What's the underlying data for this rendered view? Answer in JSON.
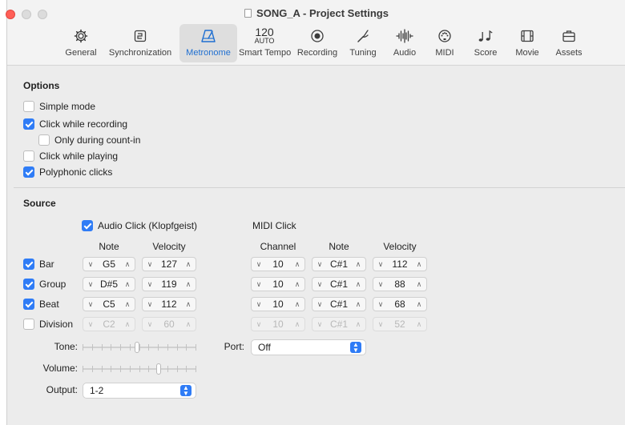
{
  "window": {
    "title": "SONG_A - Project Settings"
  },
  "tabs": [
    {
      "label": "General",
      "icon": "gear-icon"
    },
    {
      "label": "Synchronization",
      "icon": "sync-icon"
    },
    {
      "label": "Metronome",
      "icon": "metronome-icon",
      "active": true
    },
    {
      "label": "Smart Tempo",
      "icon": "smart-tempo-icon",
      "top": "120",
      "sub": "AUTO"
    },
    {
      "label": "Recording",
      "icon": "record-icon"
    },
    {
      "label": "Tuning",
      "icon": "tuning-fork-icon"
    },
    {
      "label": "Audio",
      "icon": "waveform-icon"
    },
    {
      "label": "MIDI",
      "icon": "midi-port-icon"
    },
    {
      "label": "Score",
      "icon": "music-notes-icon"
    },
    {
      "label": "Movie",
      "icon": "film-icon"
    },
    {
      "label": "Assets",
      "icon": "briefcase-icon"
    }
  ],
  "options": {
    "title": "Options",
    "items": [
      {
        "label": "Simple mode",
        "checked": false
      },
      {
        "label": "Click while recording",
        "checked": true
      },
      {
        "label": "Only during count-in",
        "checked": false
      },
      {
        "label": "Click while playing",
        "checked": false
      },
      {
        "label": "Polyphonic clicks",
        "checked": true
      }
    ]
  },
  "source": {
    "title": "Source",
    "audio_click": {
      "label": "Audio Click (Klopfgeist)",
      "checked": true
    },
    "midi_click_label": "MIDI Click",
    "headers": {
      "audio_note": "Note",
      "audio_velocity": "Velocity",
      "channel": "Channel",
      "midi_note": "Note",
      "midi_velocity": "Velocity"
    },
    "rows": [
      {
        "label": "Bar",
        "checked": true,
        "note": "G5",
        "velocity": "127",
        "channel": "10",
        "midi_note": "C#1",
        "midi_velocity": "112"
      },
      {
        "label": "Group",
        "checked": true,
        "note": "D#5",
        "velocity": "119",
        "channel": "10",
        "midi_note": "C#1",
        "midi_velocity": "88"
      },
      {
        "label": "Beat",
        "checked": true,
        "note": "C5",
        "velocity": "112",
        "channel": "10",
        "midi_note": "C#1",
        "midi_velocity": "68"
      },
      {
        "label": "Division",
        "checked": false,
        "note": "C2",
        "velocity": "60",
        "channel": "10",
        "midi_note": "C#1",
        "midi_velocity": "52"
      }
    ],
    "tone_label": "Tone:",
    "tone_value": 0.48,
    "volume_label": "Volume:",
    "volume_value": 0.68,
    "output_label": "Output:",
    "output_value": "1-2",
    "port_label": "Port:",
    "port_value": "Off"
  },
  "colors": {
    "accent": "#2f7cf6",
    "close": "#ff5f57"
  }
}
